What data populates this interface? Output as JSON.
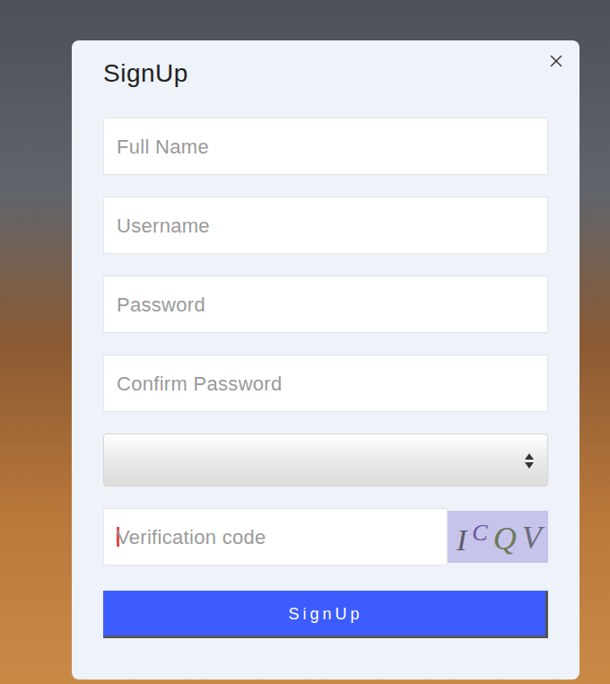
{
  "dialog": {
    "title": "SignUp",
    "close": true
  },
  "fields": [
    {
      "kind": "text",
      "placeholder": "Full Name",
      "value": ""
    },
    {
      "kind": "text",
      "placeholder": "Username",
      "value": ""
    },
    {
      "kind": "password",
      "placeholder": "Password",
      "value": ""
    },
    {
      "kind": "password",
      "placeholder": "Confirm Password",
      "value": ""
    }
  ],
  "select": {
    "value": ""
  },
  "verification": {
    "placeholder": "Verification code",
    "value": "",
    "focused": true,
    "captcha": "ICQV"
  },
  "button": {
    "label": "SignUp"
  }
}
